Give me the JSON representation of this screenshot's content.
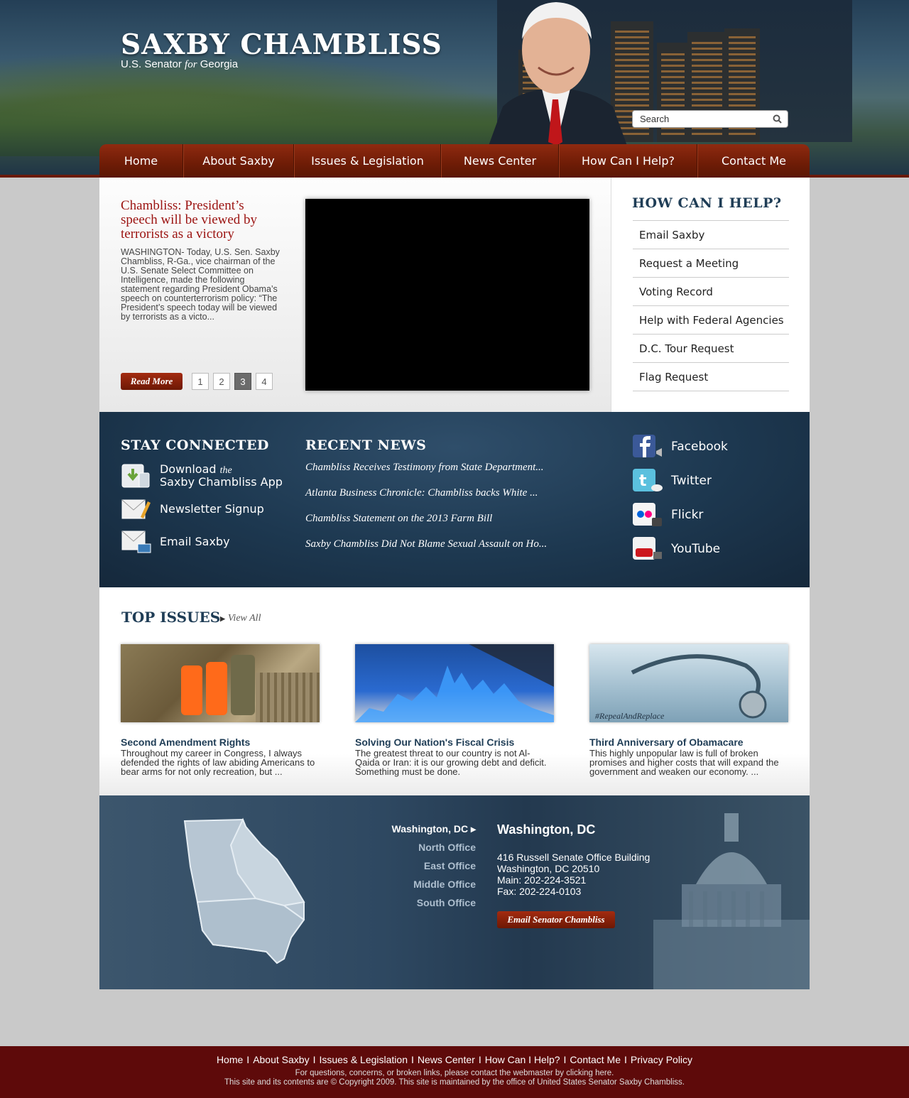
{
  "brand": {
    "name": "SAXBY CHAMBLISS",
    "sub_pre": "U.S. Senator ",
    "sub_for": "for",
    "sub_post": " Georgia"
  },
  "search": {
    "placeholder": "Search"
  },
  "nav": [
    "Home",
    "About Saxby",
    "Issues & Legislation",
    "News Center",
    "How Can I Help?",
    "Contact Me"
  ],
  "feature": {
    "title": "Chambliss: President’s speech will be viewed by terrorists as a victory",
    "text": "WASHINGTON- Today, U.S. Sen. Saxby Chambliss, R-Ga., vice chairman of the U.S. Senate Select Committee on Intelligence, made the following statement regarding President Obama’s speech on counterterrorism policy: “The President’s speech today will be viewed by terrorists as a victo...",
    "read_more": "Read More",
    "pages": [
      "1",
      "2",
      "3",
      "4"
    ],
    "active_page": "3"
  },
  "help": {
    "title": "HOW CAN I HELP?",
    "items": [
      "Email Saxby",
      "Request a Meeting",
      "Voting Record",
      "Help with Federal Agencies",
      "D.C. Tour Request",
      "Flag Request"
    ]
  },
  "connected": {
    "title": "STAY CONNECTED",
    "download_pre": "Download ",
    "download_the": "the",
    "download_app": "Saxby Chambliss App",
    "newsletter": "Newsletter Signup",
    "email": "Email Saxby"
  },
  "recent_news": {
    "title": "RECENT NEWS",
    "items": [
      "Chambliss Receives Testimony from State Department...",
      "Atlanta Business Chronicle: Chambliss backs White ...",
      "Chambliss Statement on the 2013 Farm Bill",
      "Saxby Chambliss Did Not Blame Sexual Assault on Ho..."
    ]
  },
  "social": [
    "Facebook",
    "Twitter",
    "Flickr",
    "YouTube"
  ],
  "issues": {
    "title": "TOP ISSUES",
    "view_all": "View All",
    "items": [
      {
        "title": "Second Amendment Rights",
        "text": "Throughout my career in Congress, I always defended the rights of law abiding Americans to bear arms for not only recreation, but ..."
      },
      {
        "title": "Solving Our Nation's Fiscal Crisis",
        "text": "The greatest threat to our country is not Al-Qaida or Iran: it is our growing debt and deficit. Something must be done."
      },
      {
        "title": "Third Anniversary of Obamacare",
        "text": "This highly unpopular law is full of broken promises and higher costs that will expand the government and weaken our economy. ...",
        "image_caption": "#RepealAndReplace"
      }
    ]
  },
  "offices": {
    "tabs": [
      "Washington, DC",
      "North Office",
      "East Office",
      "Middle Office",
      "South Office"
    ],
    "active": "Washington, DC",
    "heading": "Washington, DC",
    "address1": "416 Russell Senate Office Building",
    "address2": "Washington, DC 20510",
    "main": "Main: 202-224-3521",
    "fax": "Fax: 202-224-0103",
    "email_button": "Email Senator Chambliss"
  },
  "footer": {
    "links": [
      "Home",
      "About Saxby",
      "Issues & Legislation",
      "News Center",
      "How Can I Help?",
      "Contact Me",
      "Privacy Policy"
    ],
    "separator": "I",
    "line1": "For questions, concerns, or broken links, please contact the webmaster by clicking here.",
    "line2": "This site and its contents are © Copyright 2009. This site is maintained by the office of United States Senator Saxby Chambliss."
  },
  "colors": {
    "nav_red": "#7a200a",
    "navy": "#1f3d56",
    "footer_red": "#5e0a0a",
    "headline_red": "#9b1210"
  }
}
